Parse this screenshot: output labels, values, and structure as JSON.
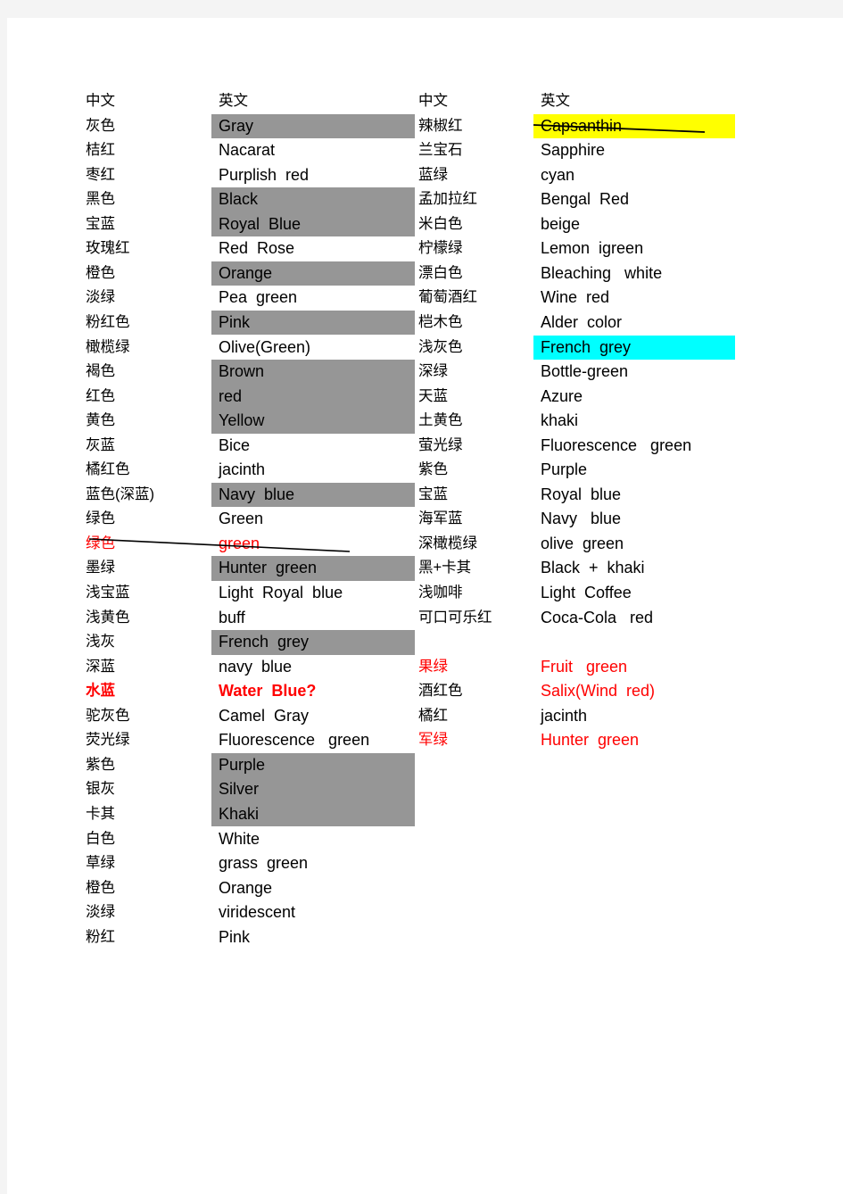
{
  "document": {
    "title": "Chinese-English Color Name Reference List"
  },
  "headers": {
    "chinese": "中文",
    "english": "英文"
  },
  "colors": {
    "gray_highlight": "#969696",
    "yellow_highlight": "#ffff00",
    "cyan_highlight": "#00ffff",
    "red_text": "#ff0000",
    "page_edge": "#f4f4f4"
  },
  "left_table": {
    "header": {
      "zh": "中文",
      "en": "英文"
    },
    "rows": [
      {
        "zh": "灰色",
        "en": "Gray",
        "highlight": "gray"
      },
      {
        "zh": "桔红",
        "en": "Nacarat",
        "highlight": "none"
      },
      {
        "zh": "枣红",
        "en": "Purplish  red",
        "highlight": "none"
      },
      {
        "zh": "黑色",
        "en": "Black",
        "highlight": "gray"
      },
      {
        "zh": "宝蓝",
        "en": "Royal  Blue",
        "highlight": "gray"
      },
      {
        "zh": "玫瑰红",
        "en": "Red  Rose",
        "highlight": "none"
      },
      {
        "zh": "橙色",
        "en": "Orange",
        "highlight": "gray"
      },
      {
        "zh": "淡绿",
        "en": "Pea  green",
        "highlight": "none"
      },
      {
        "zh": "粉红色",
        "en": "Pink",
        "highlight": "gray"
      },
      {
        "zh": "橄榄绿",
        "en": "Olive(Green)",
        "highlight": "none"
      },
      {
        "zh": "褐色",
        "en": "Brown",
        "highlight": "gray"
      },
      {
        "zh": "红色",
        "en": "red",
        "highlight": "gray"
      },
      {
        "zh": "黄色",
        "en": "Yellow",
        "highlight": "gray"
      },
      {
        "zh": "灰蓝",
        "en": "Bice",
        "highlight": "none"
      },
      {
        "zh": "橘红色",
        "en": "jacinth",
        "highlight": "none"
      },
      {
        "zh": "蓝色(深蓝)",
        "en": "Navy  blue",
        "highlight": "gray"
      },
      {
        "zh": "绿色",
        "en": "Green",
        "highlight": "none"
      },
      {
        "zh": "绿色",
        "en": "green",
        "highlight": "none",
        "red": true,
        "struck": true
      },
      {
        "zh": "墨绿",
        "en": "Hunter  green",
        "highlight": "gray"
      },
      {
        "zh": "浅宝蓝",
        "en": "Light  Royal  blue",
        "highlight": "none"
      },
      {
        "zh": "浅黄色",
        "en": "buff",
        "highlight": "none"
      },
      {
        "zh": "浅灰",
        "en": "French  grey",
        "highlight": "gray"
      },
      {
        "zh": "深蓝",
        "en": "navy  blue",
        "highlight": "none"
      },
      {
        "zh": "水蓝",
        "en": "Water  Blue?",
        "highlight": "none",
        "red": true,
        "bold": true
      },
      {
        "zh": "驼灰色",
        "en": "Camel  Gray",
        "highlight": "none"
      },
      {
        "zh": "荧光绿",
        "en": "Fluorescence   green",
        "highlight": "none"
      },
      {
        "zh": "紫色",
        "en": "Purple",
        "highlight": "gray"
      },
      {
        "zh": "银灰",
        "en": "Silver",
        "highlight": "gray"
      },
      {
        "zh": "卡其",
        "en": "Khaki",
        "highlight": "gray"
      },
      {
        "zh": "白色",
        "en": "White",
        "highlight": "none"
      },
      {
        "zh": "草绿",
        "en": "grass  green",
        "highlight": "none"
      },
      {
        "zh": "橙色",
        "en": "Orange",
        "highlight": "none"
      },
      {
        "zh": "淡绿",
        "en": "viridescent",
        "highlight": "none"
      },
      {
        "zh": "粉红",
        "en": "Pink",
        "highlight": "none"
      }
    ]
  },
  "right_table": {
    "header": {
      "zh": "中文",
      "en": "英文"
    },
    "rows": [
      {
        "zh": "辣椒红",
        "en": "Capsanthin",
        "highlight": "yellow",
        "struck": true
      },
      {
        "zh": "兰宝石",
        "en": "Sapphire",
        "highlight": "none"
      },
      {
        "zh": "蓝绿",
        "en": "cyan",
        "highlight": "none"
      },
      {
        "zh": "孟加拉红",
        "en": "Bengal  Red",
        "highlight": "none"
      },
      {
        "zh": "米白色",
        "en": "beige",
        "highlight": "none"
      },
      {
        "zh": "柠檬绿",
        "en": "Lemon  igreen",
        "highlight": "none"
      },
      {
        "zh": "漂白色",
        "en": "Bleaching   white",
        "highlight": "none"
      },
      {
        "zh": "葡萄酒红",
        "en": "Wine  red",
        "highlight": "none"
      },
      {
        "zh": "桤木色",
        "en": "Alder  color",
        "highlight": "none"
      },
      {
        "zh": "浅灰色",
        "en": "French  grey",
        "highlight": "cyan"
      },
      {
        "zh": "深绿",
        "en": "Bottle-green",
        "highlight": "none"
      },
      {
        "zh": "天蓝",
        "en": "Azure",
        "highlight": "none"
      },
      {
        "zh": "土黄色",
        "en": "khaki",
        "highlight": "none"
      },
      {
        "zh": "萤光绿",
        "en": "Fluorescence   green",
        "highlight": "none"
      },
      {
        "zh": "紫色",
        "en": "Purple",
        "highlight": "none"
      },
      {
        "zh": "宝蓝",
        "en": "Royal  blue",
        "highlight": "none"
      },
      {
        "zh": "海军蓝",
        "en": "Navy   blue",
        "highlight": "none"
      },
      {
        "zh": "深橄榄绿",
        "en": "olive  green",
        "highlight": "none"
      },
      {
        "zh": "黑+卡其",
        "en": "Black  +  khaki",
        "highlight": "none"
      },
      {
        "zh": "浅咖啡",
        "en": "Light  Coffee",
        "highlight": "none"
      },
      {
        "zh": "可口可乐红",
        "en": "Coca-Cola   red",
        "highlight": "none"
      },
      {
        "zh": "",
        "en": "",
        "highlight": "none"
      },
      {
        "zh": "果绿",
        "en": "Fruit   green",
        "highlight": "none",
        "red": true,
        "red_en": true
      },
      {
        "zh": "酒红色",
        "en": "Salix(Wind  red)",
        "highlight": "none",
        "red_en": true
      },
      {
        "zh": "橘红",
        "en": "jacinth",
        "highlight": "none"
      },
      {
        "zh": "军绿",
        "en": "Hunter  green",
        "highlight": "none",
        "red": true,
        "red_en": true
      }
    ]
  }
}
